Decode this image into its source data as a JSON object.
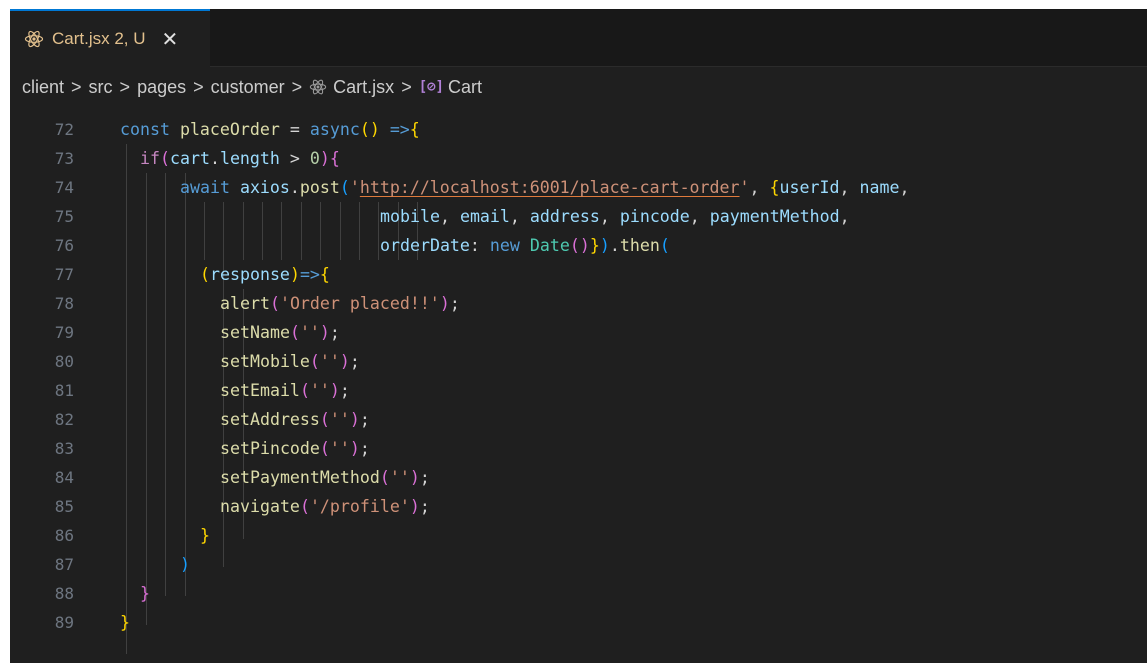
{
  "tab": {
    "label": "Cart.jsx 2, U",
    "close_symbol": "✕",
    "icon": "react-icon"
  },
  "breadcrumb": {
    "parts": [
      "client",
      "src",
      "pages",
      "customer",
      "Cart.jsx",
      "Cart"
    ],
    "separator": ">",
    "symbol_icon_text": "[⊘]"
  },
  "editor": {
    "line_numbers": [
      "72",
      "73",
      "74",
      "75",
      "76",
      "77",
      "78",
      "79",
      "80",
      "81",
      "82",
      "83",
      "84",
      "85",
      "86",
      "87",
      "88",
      "89"
    ],
    "lines": [
      "const placeOrder = async() =>{",
      "  if(cart.length > 0){",
      "      await axios.post('http://localhost:6001/place-cart-order', {userId, name,",
      "                          mobile, email, address, pincode, paymentMethod,",
      "                          orderDate: new Date()}).then(",
      "        (response)=>{",
      "          alert('Order placed!!');",
      "          setName('');",
      "          setMobile('');",
      "          setEmail('');",
      "          setAddress('');",
      "          setPincode('');",
      "          setPaymentMethod('');",
      "          navigate('/profile');",
      "        }",
      "      )",
      "  }",
      "}"
    ]
  },
  "colors": {
    "tab_accent": "#0078d4",
    "tab_label": "#e2c08d",
    "editor_bg": "#1f1f1f",
    "keyword": "#569cd6",
    "string": "#ce9178",
    "variable": "#9cdcfe",
    "function": "#dcdcaa"
  }
}
